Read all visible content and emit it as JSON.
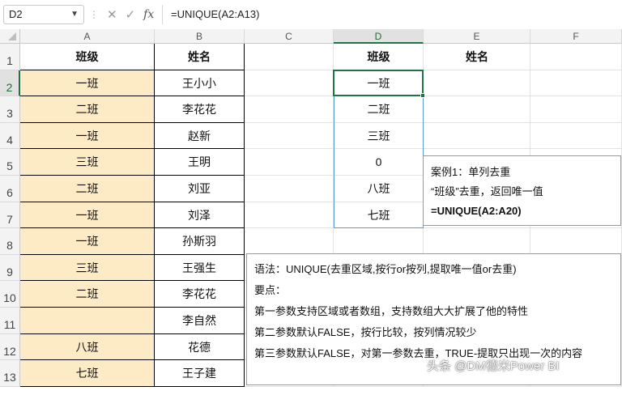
{
  "formula_bar": {
    "name_box": "D2",
    "cancel_icon": "x-icon",
    "enter_icon": "check-icon",
    "fx_label": "fx",
    "formula": "=UNIQUE(A2:A13)"
  },
  "columns": [
    "A",
    "B",
    "C",
    "D",
    "E",
    "F"
  ],
  "rows": [
    "1",
    "2",
    "3",
    "4",
    "5",
    "6",
    "7",
    "8",
    "9",
    "10",
    "11",
    "12",
    "13"
  ],
  "table_a": {
    "header": "班级",
    "values": [
      "一班",
      "二班",
      "一班",
      "三班",
      "二班",
      "一班",
      "一班",
      "三班",
      "二班",
      "",
      "八班",
      "七班"
    ]
  },
  "table_b": {
    "header": "姓名",
    "values": [
      "王小小",
      "李花花",
      "赵新",
      "王明",
      "刘亚",
      "刘泽",
      "孙斯羽",
      "王强生",
      "李花花",
      "李自然",
      "花德",
      "王子建"
    ]
  },
  "result": {
    "header_d": "班级",
    "header_e": "姓名",
    "values": [
      "一班",
      "二班",
      "三班",
      "0",
      "八班",
      "七班"
    ]
  },
  "note1": {
    "line1": "案例1：单列去重",
    "line2": "“班级”去重，返回唯一值",
    "line3": "=UNIQUE(A2:A20)"
  },
  "note2": {
    "line1": "语法：UNIQUE(去重区域,按行or按列,提取唯一值or去重)",
    "line2": "要点：",
    "line3": "第一参数支持区域或者数组，支持数组大大扩展了他的特性",
    "line4": "第二参数默认FALSE，按行比较，按列情况较少",
    "line5": "第三参数默认FALSE，对第一参数去重，TRUE-提取只出现一次的内容"
  },
  "watermark": "头条 @DM德米Power BI",
  "colors": {
    "highlight": "#fcebc4",
    "selection": "#217346",
    "grid": "#e3e3e3"
  }
}
